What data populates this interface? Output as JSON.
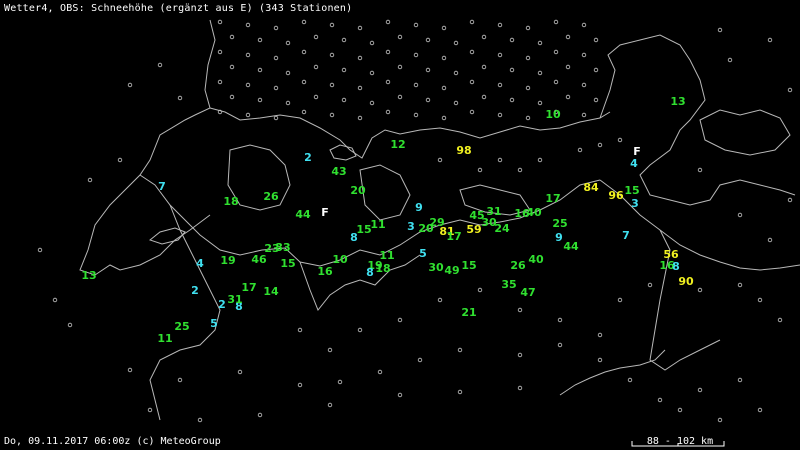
{
  "title": "Wetter4, OBS: Schneehöhe (ergänzt aus E) (343 Stationen)",
  "footer": "Do, 09.11.2017 06:00z (c) MeteoGroup",
  "scale": "88 - 102 km",
  "colors": {
    "background": "#000000",
    "border": "#b8b8b8",
    "low": "#40e0f0",
    "mid": "#30e030",
    "high": "#f0f020",
    "station": "#c8c8c8",
    "text": "#ffffff"
  },
  "markers": [
    "F",
    "F"
  ],
  "readings": [
    "13",
    "10",
    "12",
    "98",
    "2",
    "7",
    "43",
    "20",
    "84",
    "96",
    "15",
    "4",
    "3",
    "18",
    "26",
    "44",
    "9",
    "29",
    "81",
    "59",
    "45",
    "31",
    "30",
    "24",
    "16",
    "40",
    "17",
    "25",
    "9",
    "44",
    "7",
    "8",
    "15",
    "11",
    "3",
    "20",
    "17",
    "4",
    "19",
    "46",
    "23",
    "33",
    "15",
    "16",
    "10",
    "19",
    "18",
    "11",
    "5",
    "30",
    "49",
    "15",
    "26",
    "40",
    "56",
    "16",
    "8",
    "90",
    "13",
    "2",
    "17",
    "14",
    "8",
    "2",
    "31",
    "8",
    "35",
    "47",
    "5",
    "25",
    "21",
    "11"
  ]
}
